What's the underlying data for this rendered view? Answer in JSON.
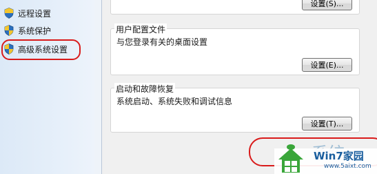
{
  "sidebar": {
    "items": [
      {
        "label": "远程设置",
        "icon": "shield-icon"
      },
      {
        "label": "系统保护",
        "icon": "shield-icon"
      },
      {
        "label": "高级系统设置",
        "icon": "shield-icon",
        "highlighted": true
      }
    ]
  },
  "dialog": {
    "performance": {
      "button_label": "设置(S)..."
    },
    "user_profiles": {
      "title": "用户配置文件",
      "description": "与您登录有关的桌面设置",
      "button_label": "设置(E)..."
    },
    "startup_recovery": {
      "title": "启动和故障恢复",
      "description": "系统启动、系统失败和调试信息",
      "button_label": "设置(T)..."
    }
  },
  "watermark": {
    "brand": "Win7家园",
    "url": "www.5aixt.com",
    "background_text": "系统"
  },
  "colors": {
    "highlight_red": "#d91a1a",
    "nav_bg": "#dce9f7",
    "dialog_bg": "#f0f0f0",
    "watermark_blue": "#1a5e9e",
    "watermark_green": "#3aa63a"
  }
}
